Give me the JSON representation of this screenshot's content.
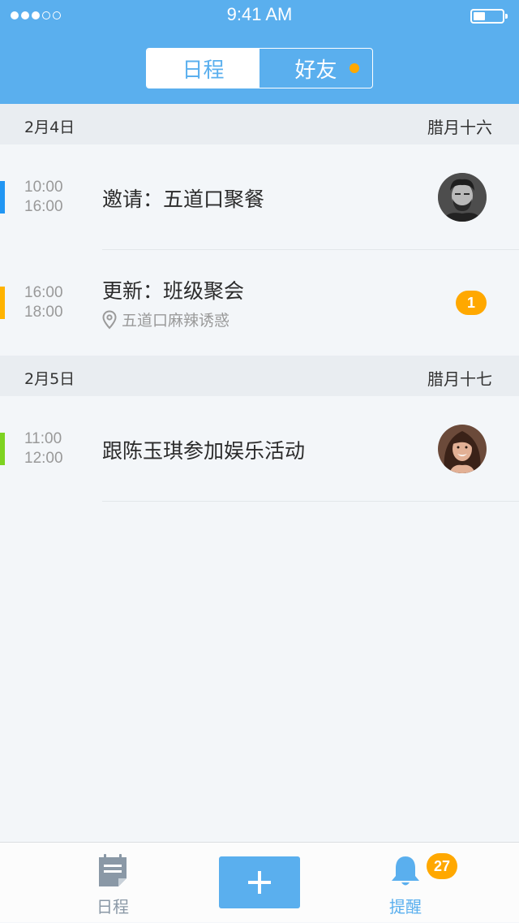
{
  "status_bar": {
    "time": "9:41 AM",
    "signal_bars_filled": 3,
    "signal_bars_total": 5,
    "battery_level": 0.35
  },
  "segmented_control": {
    "tabs": [
      {
        "label": "日程",
        "active": true
      },
      {
        "label": "好友",
        "active": false,
        "has_notification": true
      }
    ]
  },
  "days": [
    {
      "date": "2月4日",
      "lunar": "腊月十六",
      "events": [
        {
          "start": "10:00",
          "end": "16:00",
          "title": "邀请：五道口聚餐",
          "color": "#2196f3",
          "avatar": "man-avatar"
        },
        {
          "start": "16:00",
          "end": "18:00",
          "title": "更新：班级聚会",
          "location": "五道口麻辣诱惑",
          "color": "#ffb300",
          "badge": "1"
        }
      ]
    },
    {
      "date": "2月5日",
      "lunar": "腊月十七",
      "events": [
        {
          "start": "11:00",
          "end": "12:00",
          "title": "跟陈玉琪参加娱乐活动",
          "color": "#7ed321",
          "avatar": "woman-avatar"
        }
      ]
    }
  ],
  "tab_bar": {
    "schedule": {
      "label": "日程",
      "icon": "calendar-note-icon"
    },
    "add": {
      "icon": "plus-icon"
    },
    "remind": {
      "label": "提醒",
      "icon": "bell-icon",
      "badge": "27"
    }
  },
  "colors": {
    "primary": "#5aafee",
    "accent": "#ffa800"
  }
}
